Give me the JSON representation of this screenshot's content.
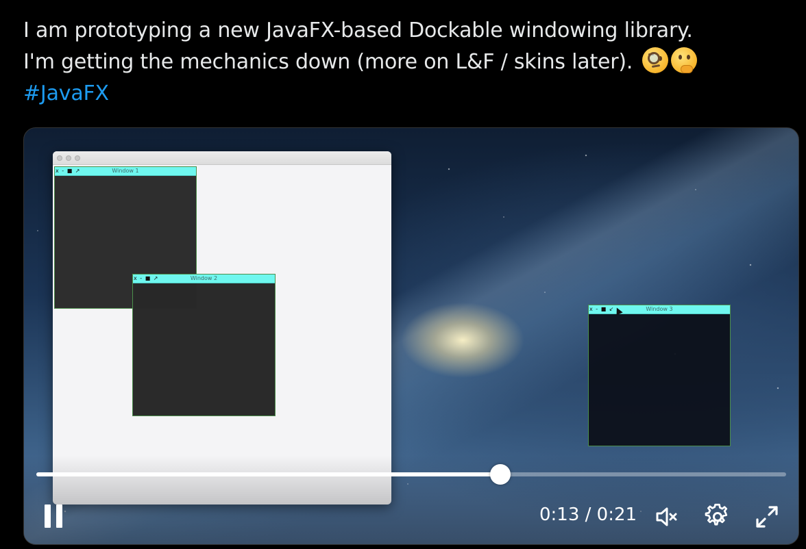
{
  "tweet": {
    "line1": "I am prototyping a new JavaFX-based Dockable windowing library.",
    "line2": "I'm getting the mechanics down (more on L&F / skins later).",
    "hashtag": "#JavaFX",
    "emojis": [
      "face-with-monocle-emoji",
      "thinking-face-emoji"
    ]
  },
  "video": {
    "dockables": [
      {
        "title": "Window 1",
        "controls": "x - ■ ↗"
      },
      {
        "title": "Window 2",
        "controls": "x - ■ ↗"
      },
      {
        "title": "Window 3",
        "controls": "x - ■ ↙"
      }
    ],
    "player": {
      "elapsed": "0:13",
      "duration": "0:21",
      "time_display": "0:13 / 0:21",
      "progress_fraction": 0.619,
      "muted": true
    }
  },
  "colors": {
    "hashtag": "#1d9bf0",
    "dock_title_bar": "#6ff7ef",
    "dock_body": "#2e2e2e"
  }
}
